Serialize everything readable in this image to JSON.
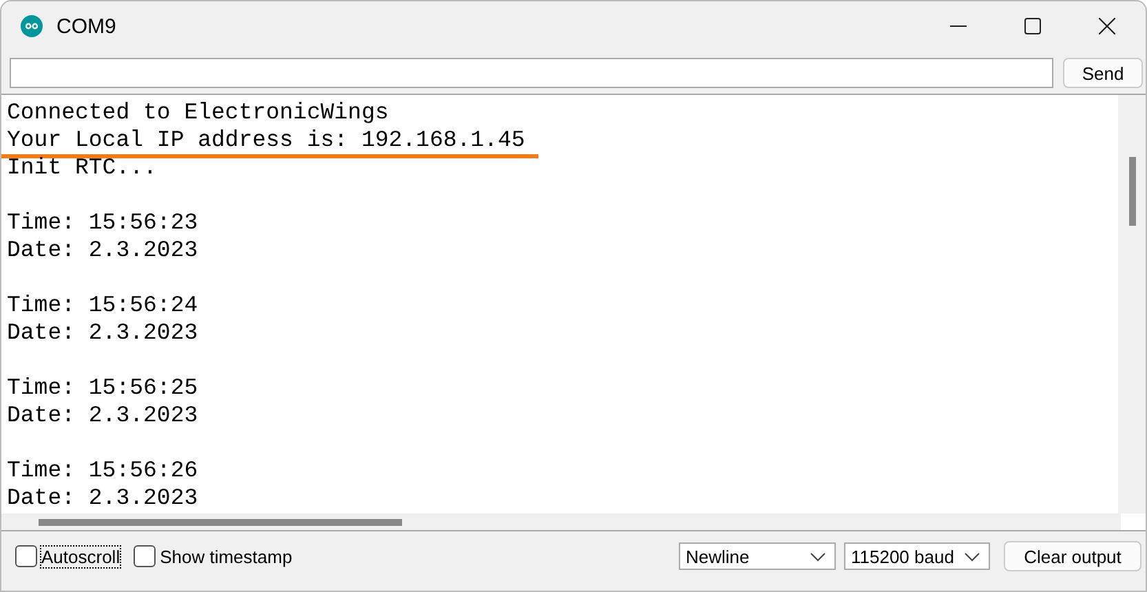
{
  "window": {
    "title": "COM9"
  },
  "send_button": "Send",
  "output": {
    "blocks": [
      [
        {
          "text": "Connected to ElectronicWings",
          "underlined": false
        },
        {
          "text": "Your Local IP address is: 192.168.1.45",
          "underlined": true
        },
        {
          "text": "Init RTC...",
          "underlined": false
        }
      ],
      [
        {
          "text": "Time: 15:56:23",
          "underlined": false
        },
        {
          "text": "Date: 2.3.2023",
          "underlined": false
        }
      ],
      [
        {
          "text": "Time: 15:56:24",
          "underlined": false
        },
        {
          "text": "Date: 2.3.2023",
          "underlined": false
        }
      ],
      [
        {
          "text": "Time: 15:56:25",
          "underlined": false
        },
        {
          "text": "Date: 2.3.2023",
          "underlined": false
        }
      ],
      [
        {
          "text": "Time: 15:56:26",
          "underlined": false
        },
        {
          "text": "Date: 2.3.2023",
          "underlined": false
        }
      ]
    ]
  },
  "footer": {
    "checkboxes": [
      {
        "label": "Autoscroll",
        "checked": false
      },
      {
        "label": "Show timestamp",
        "checked": false
      }
    ],
    "line_ending": "Newline",
    "baud_rate": "115200 baud",
    "clear_button": "Clear output"
  }
}
